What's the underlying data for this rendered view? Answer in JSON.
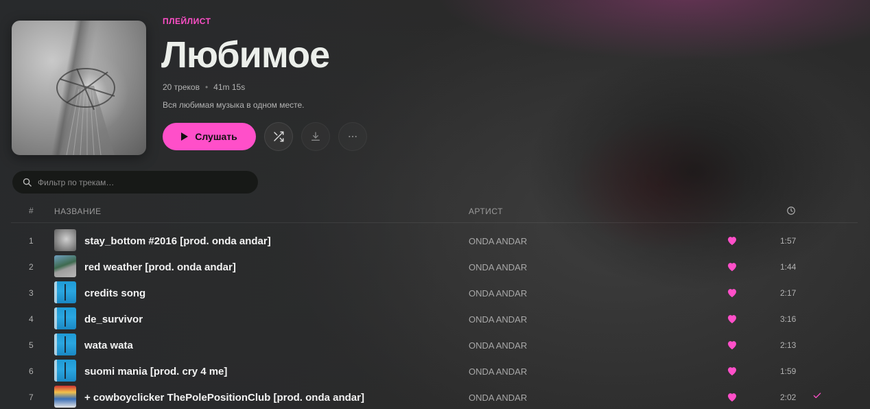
{
  "playlist": {
    "type_label": "ПЛЕЙЛИСТ",
    "title": "Любимое",
    "track_count": "20 треков",
    "duration": "41m 15s",
    "description": "Вся любимая музыка в одном месте.",
    "accent_color": "#ff4fc9"
  },
  "actions": {
    "play_label": "Слушать",
    "shuffle_icon": "shuffle-icon",
    "download_icon": "download-icon",
    "more_icon": "more-icon"
  },
  "search": {
    "placeholder": "Фильтр по трекам…"
  },
  "table": {
    "headers": {
      "num": "#",
      "title": "НАЗВАНИЕ",
      "artist": "АРТИСТ",
      "duration_icon": "clock-icon"
    },
    "tracks": [
      {
        "num": "1",
        "title": "stay_bottom #2016 [prod. onda andar]",
        "artist": "ONDA ANDAR",
        "duration": "1:57",
        "thumb": "grey",
        "liked": true,
        "downloaded": false
      },
      {
        "num": "2",
        "title": "red weather [prod. onda andar]",
        "artist": "ONDA ANDAR",
        "duration": "1:44",
        "thumb": "bridge",
        "liked": true,
        "downloaded": false
      },
      {
        "num": "3",
        "title": "credits song",
        "artist": "ONDA ANDAR",
        "duration": "2:17",
        "thumb": "blue",
        "liked": true,
        "downloaded": false
      },
      {
        "num": "4",
        "title": "de_survivor",
        "artist": "ONDA ANDAR",
        "duration": "3:16",
        "thumb": "blue",
        "liked": true,
        "downloaded": false
      },
      {
        "num": "5",
        "title": "wata wata",
        "artist": "ONDA ANDAR",
        "duration": "2:13",
        "thumb": "blue",
        "liked": true,
        "downloaded": false
      },
      {
        "num": "6",
        "title": "suomi mania [prod. cry 4 me]",
        "artist": "ONDA ANDAR",
        "duration": "1:59",
        "thumb": "blue",
        "liked": true,
        "downloaded": false
      },
      {
        "num": "7",
        "title": "+ cowboyclicker ThePolePositionClub [prod. onda andar]",
        "artist": "ONDA ANDAR",
        "duration": "2:02",
        "thumb": "color",
        "liked": true,
        "downloaded": true
      }
    ]
  }
}
